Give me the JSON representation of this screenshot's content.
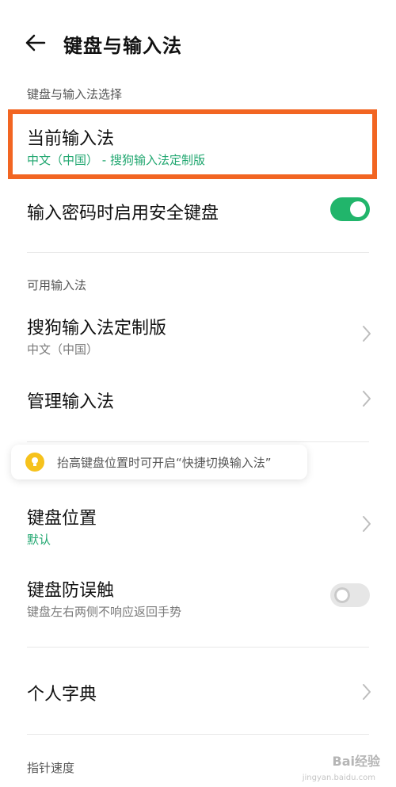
{
  "header": {
    "title": "键盘与输入法"
  },
  "sections": {
    "keyboard_input_select": "键盘与输入法选择",
    "available_inputs": "可用输入法",
    "pointer_speed": "指针速度"
  },
  "current_input": {
    "title": "当前输入法",
    "value": "中文（中国） - 搜狗输入法定制版"
  },
  "secure_keyboard": {
    "title": "输入密码时启用安全键盘",
    "enabled": true
  },
  "sogou_custom": {
    "title": "搜狗输入法定制版",
    "sub": "中文（中国）"
  },
  "manage_input": {
    "title": "管理输入法"
  },
  "tip": {
    "text": "抬高键盘位置时可开启“快捷切换输入法”"
  },
  "keyboard_position": {
    "title": "键盘位置",
    "value": "默认"
  },
  "anti_mistouch": {
    "title": "键盘防误触",
    "sub": "键盘左右两侧不响应返回手势",
    "enabled": false
  },
  "personal_dictionary": {
    "title": "个人字典"
  },
  "colors": {
    "accent_green": "#21b56b",
    "highlight_orange": "#f26522",
    "tip_yellow": "#f6c21c"
  },
  "watermark": {
    "brand": "Bai经验",
    "domain": "jingyan.baidu.com"
  }
}
